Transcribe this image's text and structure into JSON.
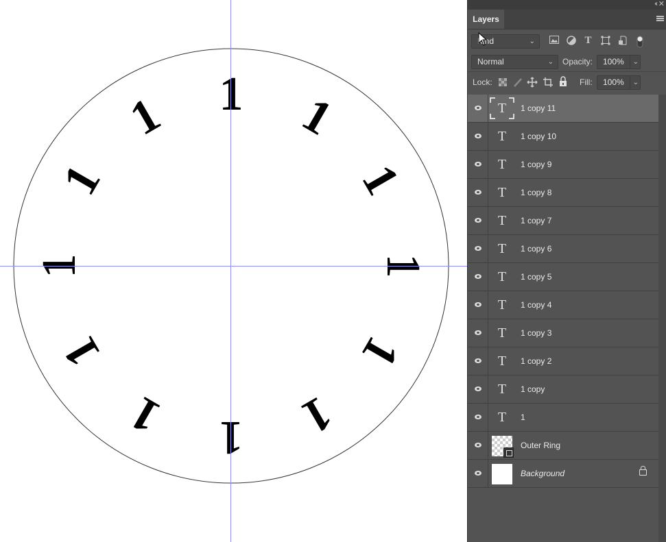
{
  "canvas": {
    "glyph_char": "1",
    "glyph_count": 12,
    "ring_color": "#333333",
    "guide_color": "#8f8ff5"
  },
  "panel": {
    "tab_label": "Layers",
    "collapse_glyph": "‹‹",
    "close_glyph": "✕",
    "filter": {
      "value": "Kind",
      "chevron": "⌵"
    },
    "filter_icons": [
      "image-filter-icon",
      "adjustment-filter-icon",
      "type-filter-icon",
      "shape-filter-icon",
      "smart-object-filter-icon",
      "filter-toggle-icon"
    ],
    "blend_mode": "Normal",
    "opacity_label": "Opacity:",
    "opacity_value": "100%",
    "lock_label": "Lock:",
    "fill_label": "Fill:",
    "fill_value": "100%",
    "layers": [
      {
        "name": "1 copy 11",
        "type": "text",
        "selected": true
      },
      {
        "name": "1 copy 10",
        "type": "text"
      },
      {
        "name": "1 copy 9",
        "type": "text"
      },
      {
        "name": "1 copy 8",
        "type": "text"
      },
      {
        "name": "1 copy 7",
        "type": "text"
      },
      {
        "name": "1 copy 6",
        "type": "text"
      },
      {
        "name": "1 copy 5",
        "type": "text"
      },
      {
        "name": "1 copy 4",
        "type": "text"
      },
      {
        "name": "1 copy 3",
        "type": "text"
      },
      {
        "name": "1 copy 2",
        "type": "text"
      },
      {
        "name": "1 copy",
        "type": "text"
      },
      {
        "name": "1",
        "type": "text"
      },
      {
        "name": "Outer Ring",
        "type": "shape"
      },
      {
        "name": "Background",
        "type": "background",
        "locked": true
      }
    ],
    "text_thumb_glyph": "T"
  }
}
